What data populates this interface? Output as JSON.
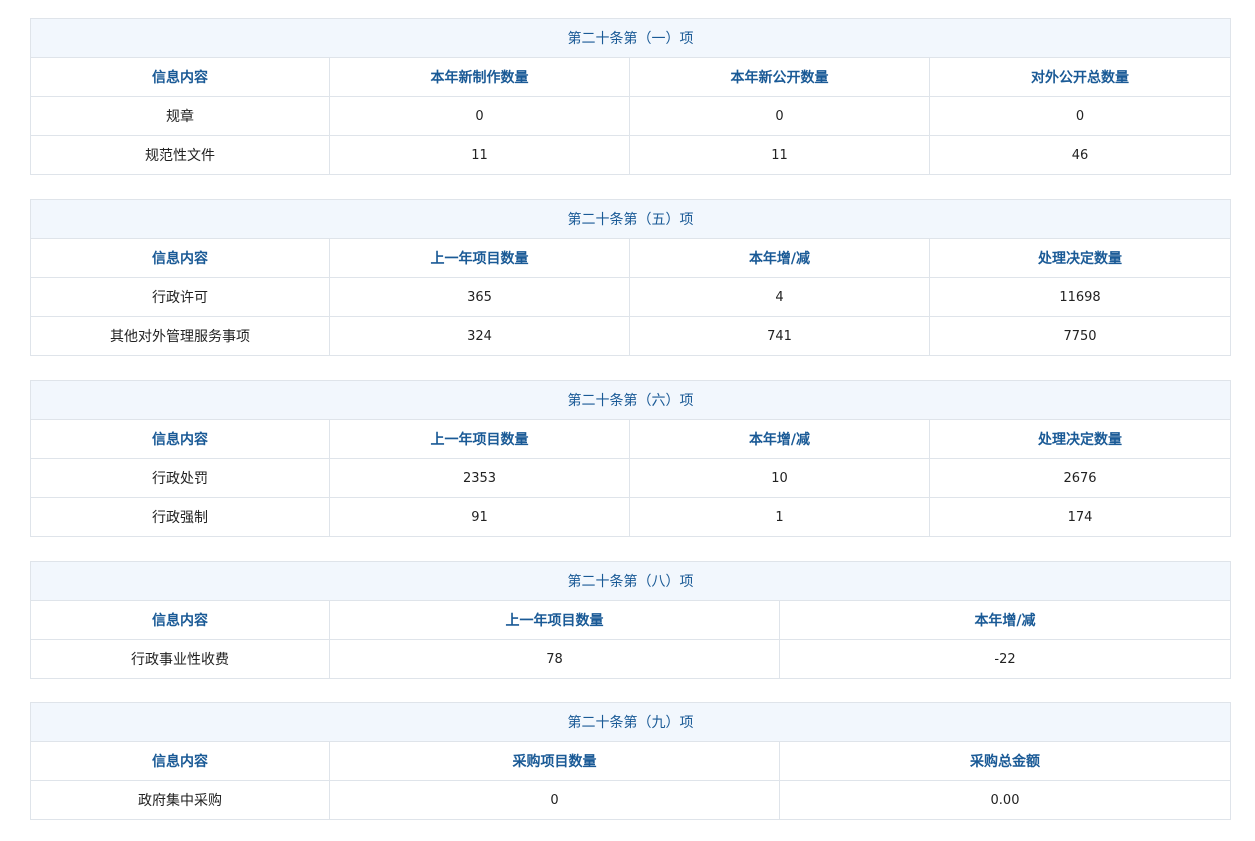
{
  "tables": [
    {
      "title": "第二十条第（一）项",
      "headers": [
        "信息内容",
        "本年新制作数量",
        "本年新公开数量",
        "对外公开总数量"
      ],
      "rows": [
        [
          "规章",
          "0",
          "0",
          "0"
        ],
        [
          "规范性文件",
          "11",
          "11",
          "46"
        ]
      ]
    },
    {
      "title": "第二十条第（五）项",
      "headers": [
        "信息内容",
        "上一年项目数量",
        "本年增/减",
        "处理决定数量"
      ],
      "rows": [
        [
          "行政许可",
          "365",
          "4",
          "11698"
        ],
        [
          "其他对外管理服务事项",
          "324",
          "741",
          "7750"
        ]
      ]
    },
    {
      "title": "第二十条第（六）项",
      "headers": [
        "信息内容",
        "上一年项目数量",
        "本年增/减",
        "处理决定数量"
      ],
      "rows": [
        [
          "行政处罚",
          "2353",
          "10",
          "2676"
        ],
        [
          "行政强制",
          "91",
          "1",
          "174"
        ]
      ]
    },
    {
      "title": "第二十条第（八）项",
      "headers": [
        "信息内容",
        "上一年项目数量",
        "本年增/减"
      ],
      "rows": [
        [
          "行政事业性收费",
          "78",
          "-22"
        ]
      ]
    },
    {
      "title": "第二十条第（九）项",
      "headers": [
        "信息内容",
        "采购项目数量",
        "采购总金额"
      ],
      "rows": [
        [
          "政府集中采购",
          "0",
          "0.00"
        ]
      ]
    }
  ],
  "colors": {
    "title_bg": "#f2f7fd",
    "title_text": "#1a5a96",
    "border": "#dfe4ea"
  }
}
